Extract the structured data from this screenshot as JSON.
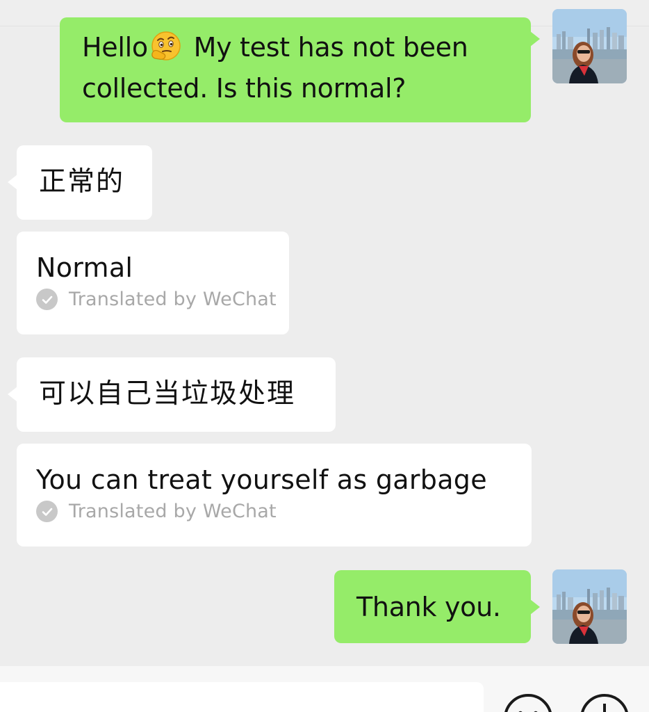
{
  "messages": [
    {
      "side": "outgoing",
      "text_before_emoji": "Hello",
      "emoji": "thinking-face-emoji",
      "text_after_emoji": " My test has not been",
      "text_line2": "collected. Is this normal?"
    },
    {
      "side": "incoming",
      "text": "正常的"
    },
    {
      "side": "incoming",
      "text": "Normal",
      "translation_label": "Translated by WeChat"
    },
    {
      "side": "incoming",
      "text": "可以自己当垃圾处理"
    },
    {
      "side": "incoming",
      "text": "You can treat yourself as garbage",
      "translation_label": "Translated by WeChat"
    },
    {
      "side": "outgoing",
      "text": "Thank you."
    }
  ],
  "input_bar": {
    "icons": [
      "emoji-icon",
      "plus-icon"
    ]
  },
  "colors": {
    "background": "#ededed",
    "outgoing_bubble": "#95ec69",
    "incoming_bubble": "#ffffff",
    "translation_text": "#a8a8a8"
  }
}
